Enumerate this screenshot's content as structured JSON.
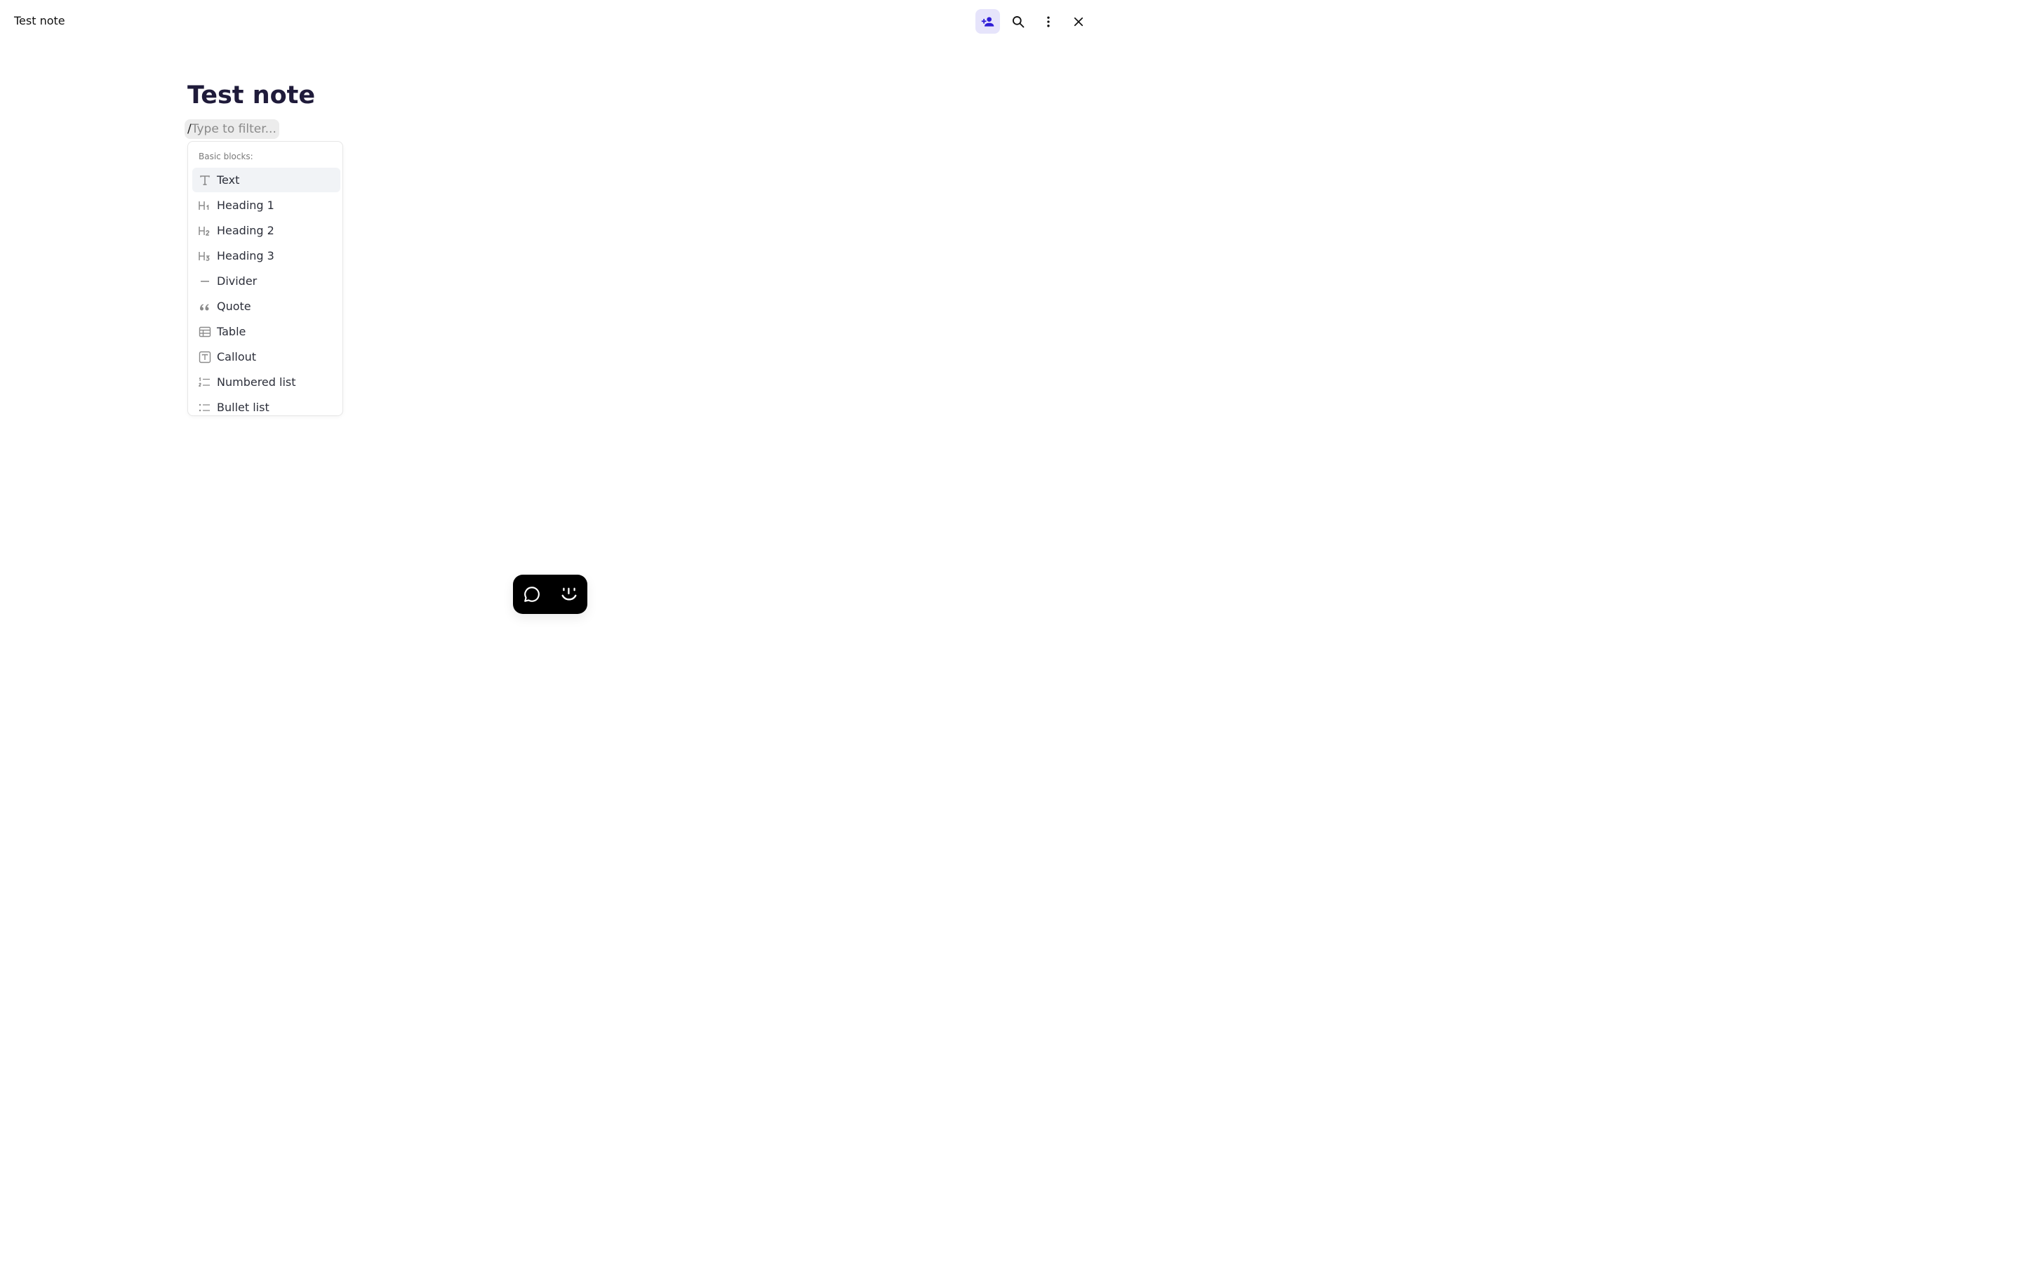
{
  "window": {
    "title": "Test note"
  },
  "header": {
    "actions": [
      {
        "icon": "add-person-icon",
        "active": true
      },
      {
        "icon": "search-icon",
        "active": false
      },
      {
        "icon": "more-vertical-icon",
        "active": false
      },
      {
        "icon": "close-icon",
        "active": false
      }
    ],
    "accent_color": "#2f1dd6",
    "active_bg": "#e6e4fb"
  },
  "note": {
    "title": "Test note"
  },
  "filter": {
    "slash": "/",
    "placeholder": "Type to filter..."
  },
  "menu": {
    "heading": "Basic blocks:",
    "items": [
      {
        "label": "Text",
        "icon": "text-icon",
        "selected": true
      },
      {
        "label": "Heading 1",
        "icon": "heading-1-icon"
      },
      {
        "label": "Heading 2",
        "icon": "heading-2-icon"
      },
      {
        "label": "Heading 3",
        "icon": "heading-3-icon"
      },
      {
        "label": "Divider",
        "icon": "divider-icon"
      },
      {
        "label": "Quote",
        "icon": "quote-icon"
      },
      {
        "label": "Table",
        "icon": "table-icon"
      },
      {
        "label": "Callout",
        "icon": "callout-icon"
      },
      {
        "label": "Numbered list",
        "icon": "numbered-list-icon"
      },
      {
        "label": "Bullet list",
        "icon": "bullet-list-icon"
      }
    ]
  },
  "toolbar": {
    "items": [
      {
        "icon": "chat-bubble-icon"
      },
      {
        "icon": "assistant-face-icon"
      }
    ]
  }
}
